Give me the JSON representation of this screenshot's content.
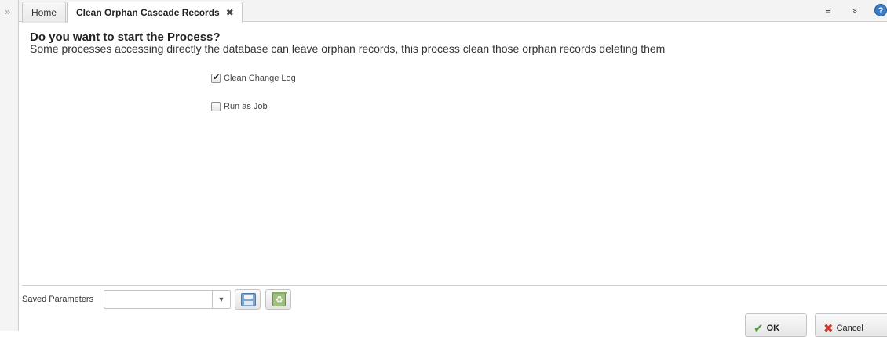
{
  "sidebar": {
    "expand_glyph": "»",
    "expand_icon": "double-chevron-right-icon"
  },
  "tabs": [
    {
      "label": "Home",
      "active": false
    },
    {
      "label": "Clean Orphan Cascade Records",
      "active": true,
      "close_glyph": "✖"
    }
  ],
  "toolbar": {
    "menu_glyph": "≡",
    "collapse_glyph": "»",
    "help_glyph": "?"
  },
  "process": {
    "title": "Do you want to start the Process?",
    "description": "Some processes accessing directly the database can leave orphan records, this process clean those orphan records deleting them"
  },
  "parameters": [
    {
      "label": "Clean Change Log",
      "checked": true
    },
    {
      "label": "Run as Job",
      "checked": false
    }
  ],
  "footer": {
    "saved_parameters_label": "Saved Parameters",
    "saved_parameters_value": "",
    "ok_label": "OK",
    "cancel_label": "Cancel"
  },
  "colors": {
    "help_icon": "#3a7bc8",
    "ok_icon": "#4ca336",
    "cancel_icon": "#d6362b"
  }
}
